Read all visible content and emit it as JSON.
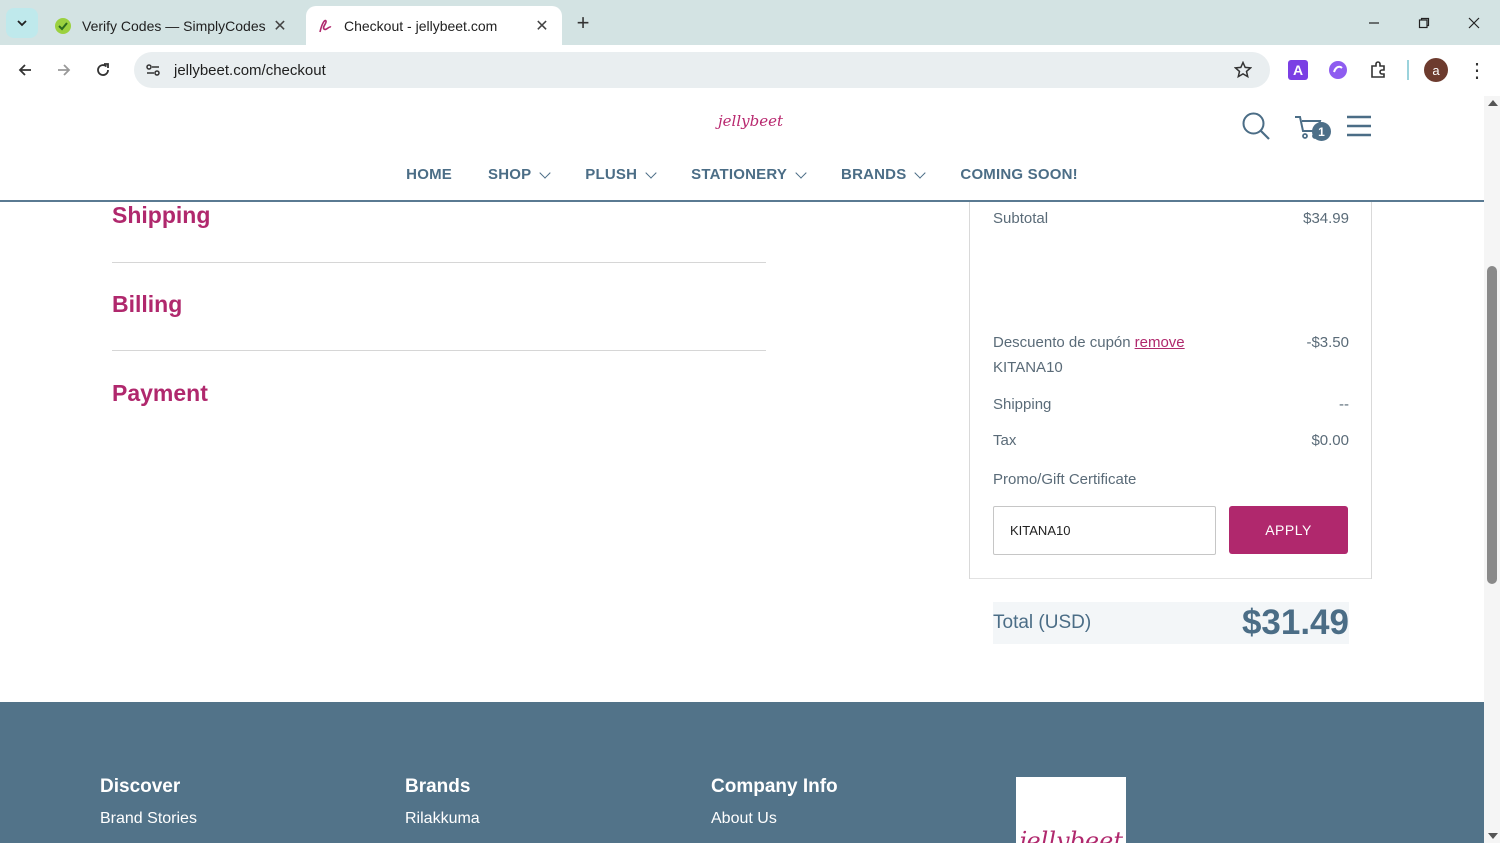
{
  "browser": {
    "tabs": [
      {
        "title": "Verify Codes — SimplyCodes",
        "active": false
      },
      {
        "title": "Checkout - jellybeet.com",
        "active": true
      }
    ],
    "url": "jellybeet.com/checkout",
    "profile_initial": "a"
  },
  "site": {
    "logo_text": "jellybeet",
    "cart_count": "1",
    "nav": [
      {
        "label": "HOME",
        "dropdown": false
      },
      {
        "label": "SHOP",
        "dropdown": true
      },
      {
        "label": "PLUSH",
        "dropdown": true
      },
      {
        "label": "STATIONERY",
        "dropdown": true
      },
      {
        "label": "BRANDS",
        "dropdown": true
      },
      {
        "label": "COMING SOON!",
        "dropdown": false
      }
    ]
  },
  "checkout": {
    "sections": [
      "Shipping",
      "Billing",
      "Payment"
    ]
  },
  "summary": {
    "subtotal_label": "Subtotal",
    "subtotal_value": "$34.99",
    "discount_label": "Descuento de cupón",
    "discount_remove": "remove",
    "discount_value": "-$3.50",
    "coupon_code": "KITANA10",
    "shipping_label": "Shipping",
    "shipping_value": "--",
    "tax_label": "Tax",
    "tax_value": "$0.00",
    "promo_label": "Promo/Gift Certificate",
    "promo_value": "KITANA10",
    "apply_label": "APPLY",
    "total_label": "Total (USD)",
    "total_value": "$31.49"
  },
  "footer": {
    "columns": [
      {
        "heading": "Discover",
        "first_link": "Brand Stories"
      },
      {
        "heading": "Brands",
        "first_link": "Rilakkuma"
      },
      {
        "heading": "Company Info",
        "first_link": "About Us"
      }
    ],
    "logo_text": "jellybeet"
  },
  "colors": {
    "brand_pink": "#b0286d",
    "brand_slate": "#4b6d86",
    "footer_bg": "#527389"
  }
}
